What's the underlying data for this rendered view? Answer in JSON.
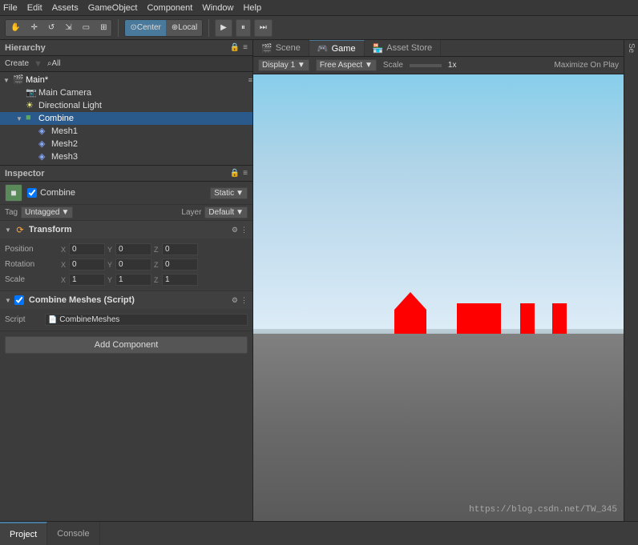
{
  "menubar": {
    "items": [
      "File",
      "Edit",
      "Assets",
      "GameObject",
      "Component",
      "Window",
      "Help"
    ]
  },
  "toolbar": {
    "hand_icon": "✋",
    "move_icon": "✛",
    "rotate_icon": "↺",
    "scale_icon": "⇲",
    "rect_icon": "▭",
    "transform_icon": "⊞",
    "center_label": "Center",
    "local_label": "Local",
    "play_icon": "▶",
    "pause_icon": "⏸",
    "step_icon": "⏭"
  },
  "hierarchy": {
    "title": "Hierarchy",
    "create_label": "Create",
    "search_label": "⌕All",
    "lock_icon": "🔒",
    "menu_icon": "≡",
    "items": [
      {
        "id": "main",
        "label": "Main*",
        "indent": 0,
        "has_arrow": true,
        "expanded": true,
        "icon": "scene"
      },
      {
        "id": "main-camera",
        "label": "Main Camera",
        "indent": 1,
        "has_arrow": false,
        "icon": "camera"
      },
      {
        "id": "directional-light",
        "label": "Directional Light",
        "indent": 1,
        "has_arrow": false,
        "icon": "light"
      },
      {
        "id": "combine",
        "label": "Combine",
        "indent": 1,
        "has_arrow": true,
        "expanded": true,
        "icon": "cube",
        "selected": true
      },
      {
        "id": "mesh1",
        "label": "Mesh1",
        "indent": 2,
        "has_arrow": false,
        "icon": "mesh"
      },
      {
        "id": "mesh2",
        "label": "Mesh2",
        "indent": 2,
        "has_arrow": false,
        "icon": "mesh"
      },
      {
        "id": "mesh3",
        "label": "Mesh3",
        "indent": 2,
        "has_arrow": false,
        "icon": "mesh"
      }
    ]
  },
  "inspector": {
    "title": "Inspector",
    "lock_icon": "🔒",
    "menu_icon": "≡",
    "object": {
      "name": "Combine",
      "checkbox_checked": true,
      "static_label": "Static",
      "tag_label": "Tag",
      "tag_value": "Untagged",
      "layer_label": "Layer",
      "layer_value": "Default"
    },
    "transform": {
      "title": "Transform",
      "position_label": "Position",
      "rotation_label": "Rotation",
      "scale_label": "Scale",
      "pos_x": "0",
      "pos_y": "0",
      "pos_z": "0",
      "rot_x": "0",
      "rot_y": "0",
      "rot_z": "0",
      "scl_x": "1",
      "scl_y": "1",
      "scl_z": "1"
    },
    "combine_meshes": {
      "title": "Combine Meshes (Script)",
      "script_label": "Script",
      "script_value": "CombineMeshes"
    },
    "add_component_label": "Add Component"
  },
  "scene_view": {
    "tabs": [
      {
        "label": "Scene",
        "icon": "🎬",
        "active": false
      },
      {
        "label": "Game",
        "icon": "🎮",
        "active": true
      },
      {
        "label": "Asset Store",
        "icon": "🏪",
        "active": false
      }
    ],
    "toolbar": {
      "display_label": "Display 1",
      "aspect_label": "Free Aspect",
      "scale_label": "Scale",
      "scale_value": "1x",
      "maximize_label": "Maximize On Play"
    }
  },
  "far_right": {
    "labels": [
      "Se"
    ]
  },
  "bottom": {
    "project_label": "Project",
    "console_label": "Console"
  },
  "watermark": "https://blog.csdn.net/TW_345"
}
